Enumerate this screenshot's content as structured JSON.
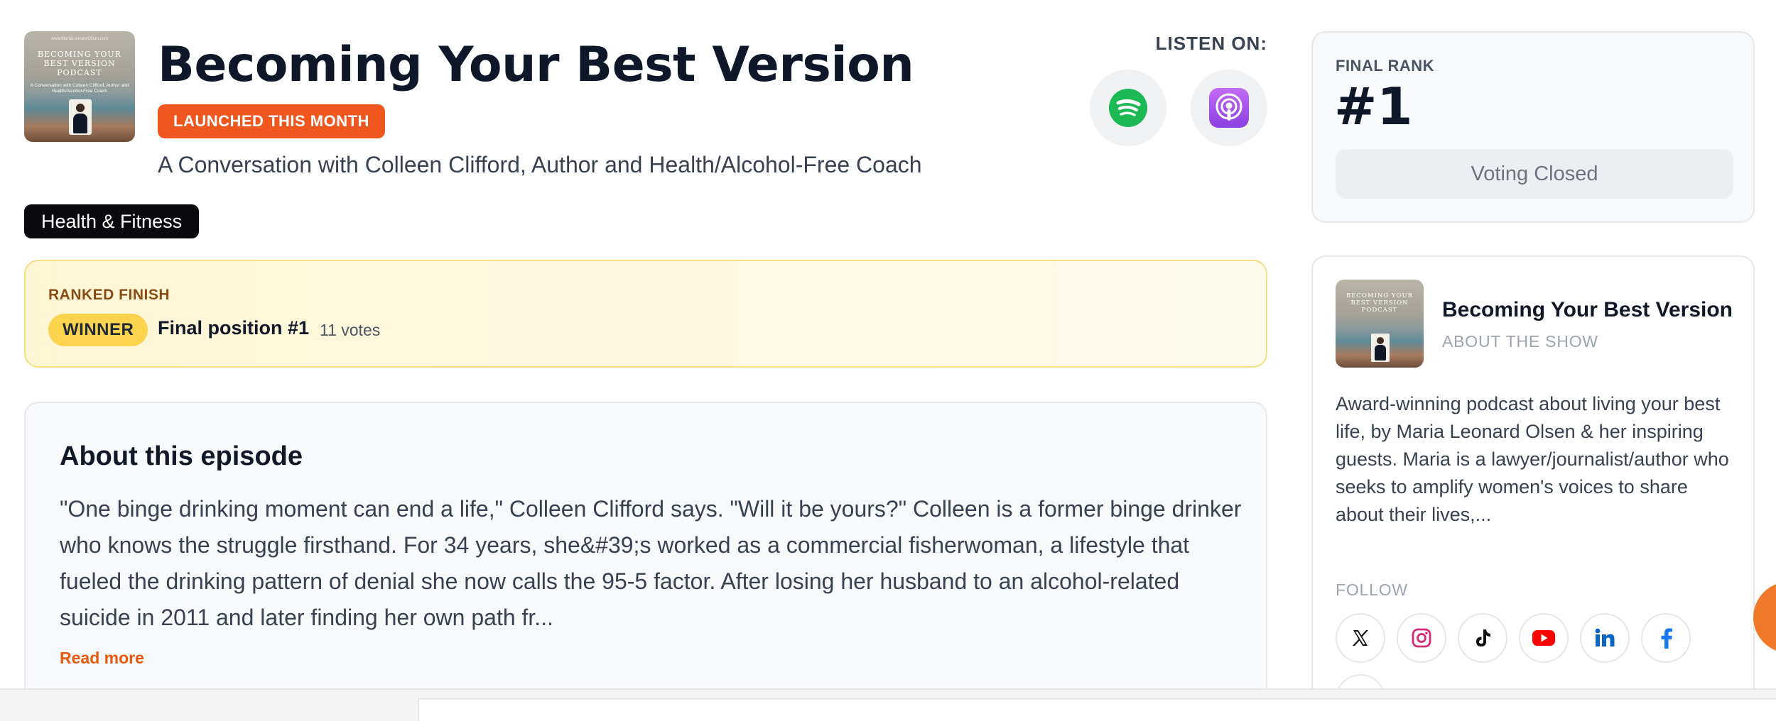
{
  "episode": {
    "cover": {
      "small_text": "www.MariaLeonardOlsen.com",
      "title": "BECOMING YOUR BEST VERSION PODCAST",
      "subtitle": "A Conversation with Colleen Clifford, Author and Health/Alcohol-Free Coach"
    },
    "title": "Becoming Your Best Version",
    "badge": "LAUNCHED THIS MONTH",
    "subtitle": "A Conversation with Colleen Clifford, Author and Health/Alcohol-Free Coach",
    "category": "Health & Fitness"
  },
  "listen": {
    "label": "LISTEN ON:",
    "platforms": [
      {
        "name": "Spotify",
        "icon": "spotify-icon",
        "color": "#1db954"
      },
      {
        "name": "Apple Podcasts",
        "icon": "apple-podcasts-icon",
        "color": "#a855f7"
      }
    ]
  },
  "ranked": {
    "label": "RANKED FINISH",
    "badge": "WINNER",
    "position": "Final position #1",
    "votes": "11 votes"
  },
  "about": {
    "title": "About this episode",
    "body": "\"One binge drinking moment can end a life,\" Colleen Clifford says.  \"Will it be yours?\" Colleen is a former binge drinker who knows the struggle firsthand.  For 34 years, she&#39;s worked as a commercial fisherwoman, a lifestyle that fueled the drinking pattern of denial she now calls the 95-5 factor.  After losing her husband to an alcohol-related suicide in 2011 and later finding her own path fr...",
    "read_more": "Read more"
  },
  "rank": {
    "label": "FINAL RANK",
    "value": "#1",
    "status": "Voting Closed"
  },
  "show": {
    "name": "Becoming Your Best Version",
    "section": "ABOUT THE SHOW",
    "description": "Award-winning podcast about living your best life, by Maria Leonard Olsen & her inspiring guests. Maria is a lawyer/journalist/author who seeks to amplify women's voices to share about their lives,...",
    "follow_label": "FOLLOW",
    "socials": [
      {
        "name": "X",
        "icon": "x-icon"
      },
      {
        "name": "Instagram",
        "icon": "instagram-icon"
      },
      {
        "name": "TikTok",
        "icon": "tiktok-icon"
      },
      {
        "name": "YouTube",
        "icon": "youtube-icon"
      },
      {
        "name": "LinkedIn",
        "icon": "linkedin-icon"
      },
      {
        "name": "Facebook",
        "icon": "facebook-icon"
      }
    ]
  },
  "colors": {
    "accent": "#f0571f",
    "winner": "#fcd34d",
    "dark": "#0f172a"
  }
}
